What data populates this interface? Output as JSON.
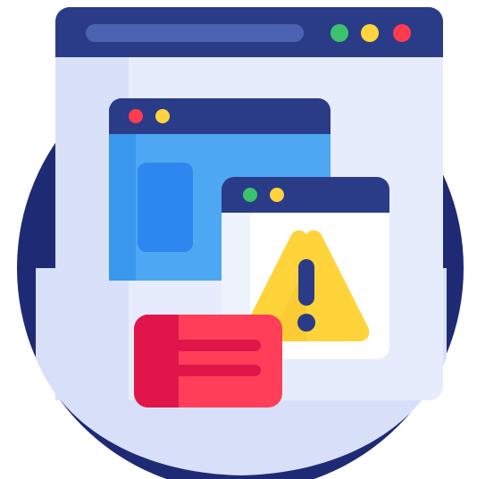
{
  "icon": "browser-error-warning-icon",
  "colors": {
    "navy_circle": "#1E2A73",
    "window_frame": "#2A3B87",
    "window_body": "#E6ECFB",
    "blue_window": "#4DA7F3",
    "blue_window_dark": "#2C88EE",
    "white_window": "#FFFFFF",
    "warning_yellow": "#FFD43B",
    "warning_mark": "#2A3B87",
    "dot_green": "#3CC26E",
    "dot_yellow": "#FFD43B",
    "dot_red": "#FF3B4E",
    "message_red": "#FF3E5A",
    "message_red_dark": "#E0164A"
  }
}
